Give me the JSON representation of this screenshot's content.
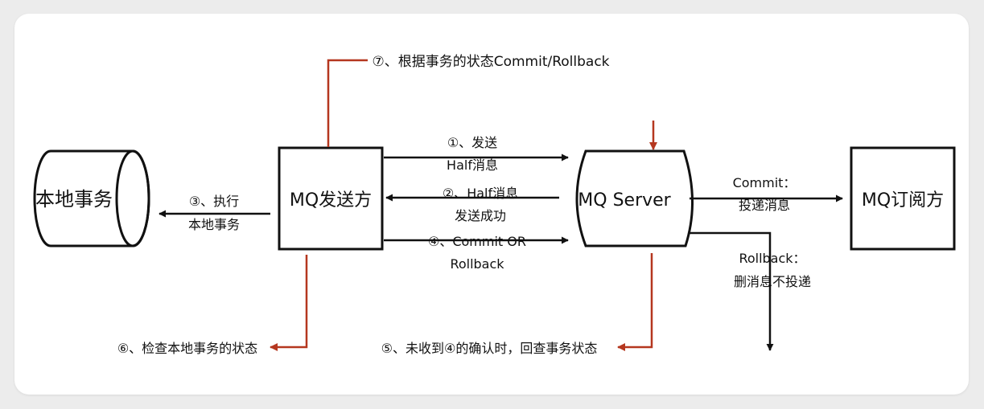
{
  "colors": {
    "black": "#111111",
    "red": "#b5371f",
    "background": "#ececec",
    "card": "#ffffff"
  },
  "nodes": {
    "local_tx": "本地事务",
    "producer": "MQ发送方",
    "server": "MQ Server",
    "subscriber": "MQ订阅方"
  },
  "edges": {
    "step1_line1": "①、发送",
    "step1_line2": "Half消息",
    "step2_line1": "②、Half消息",
    "step2_line2": "发送成功",
    "step3_line1": "③、执行",
    "step3_line2": "本地事务",
    "step4_line1": "④、Commit OR",
    "step4_line2": "Rollback",
    "step5": "⑤、未收到④的确认时，回查事务状态",
    "step6": "⑥、检查本地事务的状态",
    "step7": "⑦、根据事务的状态Commit/Rollback",
    "commit_line1": "Commit：",
    "commit_line2": "投递消息",
    "rollback_line1": "Rollback：",
    "rollback_line2": "删消息不投递"
  }
}
